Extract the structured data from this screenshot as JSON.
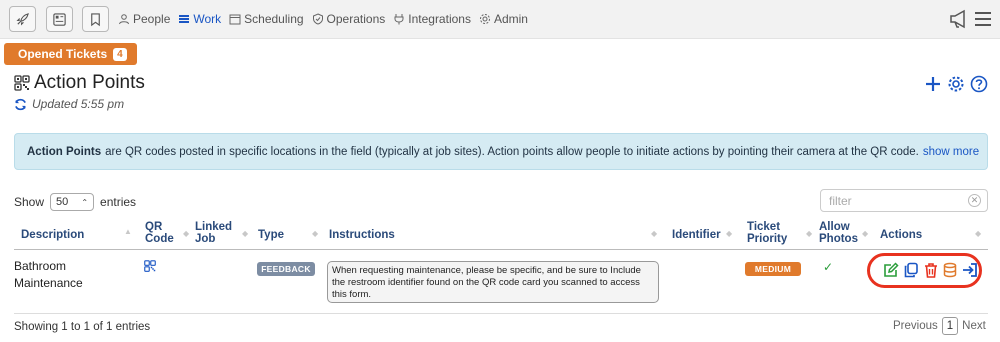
{
  "nav": {
    "links": [
      {
        "label": "People",
        "icon": "person-icon"
      },
      {
        "label": "Work",
        "icon": "list-icon"
      },
      {
        "label": "Scheduling",
        "icon": "calendar-icon"
      },
      {
        "label": "Operations",
        "icon": "shield-check-icon"
      },
      {
        "label": "Integrations",
        "icon": "plug-icon"
      },
      {
        "label": "Admin",
        "icon": "gear-icon"
      }
    ]
  },
  "tickets_tab": {
    "label": "Opened Tickets",
    "count": "4"
  },
  "page": {
    "title": "Action Points",
    "updated": "Updated 5:55 pm"
  },
  "info": {
    "bold": "Action Points",
    "text": "are QR codes posted in specific locations in the field (typically at job sites). Action points allow people to initiate actions by pointing their camera at the QR code.",
    "more": "show more"
  },
  "table_controls": {
    "show": "Show",
    "entries_value": "50",
    "entries": "entries",
    "filter_placeholder": "filter"
  },
  "columns": {
    "description": "Description",
    "qr_code_1": "QR",
    "qr_code_2": "Code",
    "linked_job_1": "Linked",
    "linked_job_2": "Job",
    "type": "Type",
    "instructions": "Instructions",
    "identifier": "Identifier",
    "ticket_priority_1": "Ticket",
    "ticket_priority_2": "Priority",
    "allow_photos_1": "Allow",
    "allow_photos_2": "Photos",
    "actions": "Actions"
  },
  "rows": [
    {
      "description_1": "Bathroom",
      "description_2": "Maintenance",
      "type": "FEEDBACK",
      "instructions": "When requesting maintenance, please be specific, and be sure to Include the restroom identifier found on the QR code card you scanned to access this form.",
      "priority": "MEDIUM",
      "allow_photos": "✓"
    }
  ],
  "footer": {
    "summary": "Showing 1 to 1 of 1 entries",
    "previous": "Previous",
    "page": "1",
    "next": "Next"
  },
  "colors": {
    "accent": "#1a56c4",
    "orange": "#e07a2c",
    "red": "#e8321f",
    "green": "#2a9d3a"
  }
}
